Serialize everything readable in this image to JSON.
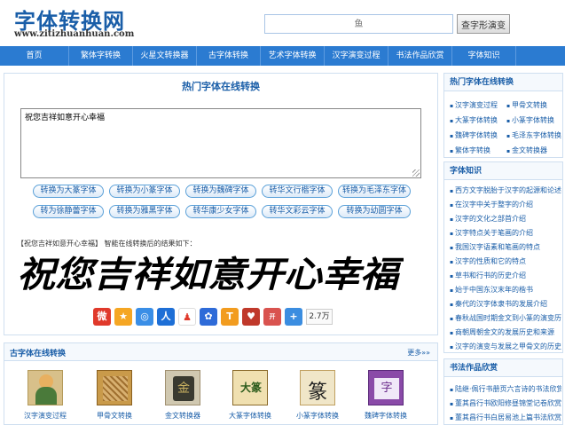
{
  "header": {
    "logo_text": "字体转换网",
    "logo_url": "www.zitizhuanhuan.com",
    "search_placeholder": "鱼",
    "search_button": "查字形演变"
  },
  "nav": {
    "items": [
      "首页",
      "繁体字转换",
      "火星文转换器",
      "古字体转换",
      "艺术字体转换",
      "汉字演变过程",
      "书法作品欣赏",
      "字体知识"
    ]
  },
  "main": {
    "title": "热门字体在线转换",
    "textarea_value": "祝您吉祥如意开心幸福",
    "buttons_row1": [
      "转换为大篆字体",
      "转换为小篆字体",
      "转换为魏碑字体",
      "转华文行楷字体",
      "转换为毛泽东字体"
    ],
    "buttons_row2": [
      "转为徐静蕾字体",
      "转换为雅黑字体",
      "转华康少女字体",
      "转华文彩云字体",
      "转换为幼圆字体"
    ],
    "result_line": "【祝您吉祥如意开心幸福】 智能在线转换后的结果如下：",
    "calligraphy_text": "祝您吉祥如意开心幸福",
    "share_count": "2.7万"
  },
  "ancient": {
    "title": "古字体在线转换",
    "more": "更多»»",
    "items": [
      "汉字演变过程",
      "甲骨文转换",
      "金文转换器",
      "大篆字体转换",
      "小篆字体转换",
      "魏碑字体转换"
    ],
    "thumb_glyphs": [
      "汉",
      "甲",
      "金",
      "大篆",
      "篆",
      "字"
    ]
  },
  "side_convert": {
    "title": "热门字体在线转换",
    "links": [
      "汉字演变过程",
      "甲骨文转换",
      "大篆字体转换",
      "小篆字体转换",
      "魏碑字体转换",
      "毛泽东字体转换",
      "繁体字转换",
      "金文转换器"
    ]
  },
  "side_knowledge": {
    "title": "字体知识",
    "items": [
      "西方文字脱胎于汉字的起源和论述",
      "在汉字中关于整字的介绍",
      "汉字的文化之部首介绍",
      "汉字特点关于笔画的介绍",
      "我国汉字语素和笔画的特点",
      "汉字的性质和它的特点",
      "草书和行书的历史介绍",
      "始于中国东汉末年的楷书",
      "秦代的汉字体隶书的发展介绍",
      "春秋战国时期金文到小篆的演变历",
      "商朝周朝金文的发展历史和来源",
      "汉字的演变与发展之甲骨文的历史"
    ]
  },
  "side_works": {
    "title": "书法作品欣赏",
    "items": [
      "陆继·佩行书册页六言诗的书法欣赏",
      "董其昌行书欧阳修昼锦堂记卷欣赏",
      "董其昌行书白居易池上篇书法欣赏"
    ]
  },
  "colors": {
    "nav_bg": "#2b7bd1",
    "accent": "#1a5ea8"
  }
}
